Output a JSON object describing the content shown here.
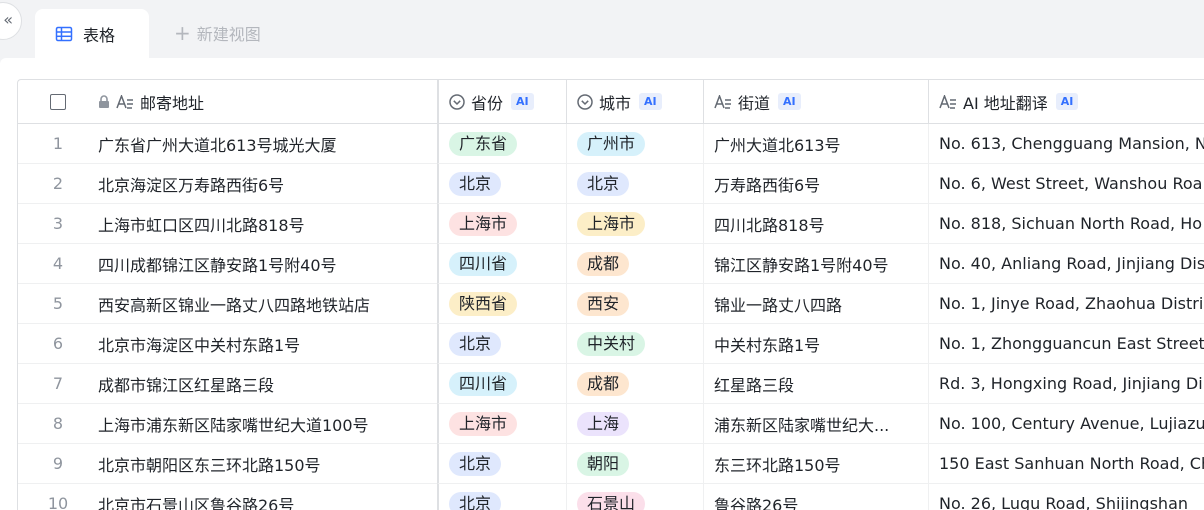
{
  "tabs": {
    "active_label": "表格",
    "new_view_label": "新建视图"
  },
  "columns": {
    "address": "邮寄地址",
    "province": "省份",
    "city": "城市",
    "street": "街道",
    "translation": "AI 地址翻译",
    "ai_badge": "AI"
  },
  "tag_colors": {
    "green": "#d9f5e5",
    "blue": "#dfe8fd",
    "red": "#fde2e2",
    "yellow": "#fceec7",
    "cyan": "#d6f1fb",
    "orange": "#fde6cf",
    "purple": "#ebe3fc",
    "pink": "#fbdfea"
  },
  "rows": [
    {
      "index": "1",
      "address": "广东省广州大道北613号城光大厦",
      "province": "广东省",
      "province_color": "green",
      "city": "广州市",
      "city_color": "cyan",
      "street": "广州大道北613号",
      "translation": "No. 613, Chengguang Mansion, N"
    },
    {
      "index": "2",
      "address": "北京海淀区万寿路西街6号",
      "province": "北京",
      "province_color": "blue",
      "city": "北京",
      "city_color": "blue",
      "street": "万寿路西街6号",
      "translation": "No. 6, West Street, Wanshou Roa"
    },
    {
      "index": "3",
      "address": "上海市虹口区四川北路818号",
      "province": "上海市",
      "province_color": "red",
      "city": "上海市",
      "city_color": "yellow",
      "street": "四川北路818号",
      "translation": "No. 818, Sichuan North Road, Ho"
    },
    {
      "index": "4",
      "address": "四川成都锦江区静安路1号附40号",
      "province": "四川省",
      "province_color": "cyan",
      "city": "成都",
      "city_color": "orange",
      "street": "锦江区静安路1号附40号",
      "translation": "No. 40, Anliang Road, Jinjiang Dis"
    },
    {
      "index": "5",
      "address": "西安高新区锦业一路丈八四路地铁站店",
      "province": "陕西省",
      "province_color": "yellow",
      "city": "西安",
      "city_color": "orange",
      "street": "锦业一路丈八四路",
      "translation": "No. 1, Jinye Road, Zhaohua Distri"
    },
    {
      "index": "6",
      "address": "北京市海淀区中关村东路1号",
      "province": "北京",
      "province_color": "blue",
      "city": "中关村",
      "city_color": "green",
      "street": "中关村东路1号",
      "translation": "No. 1, Zhongguancun East Street,"
    },
    {
      "index": "7",
      "address": "成都市锦江区红星路三段",
      "province": "四川省",
      "province_color": "cyan",
      "city": "成都",
      "city_color": "orange",
      "street": "红星路三段",
      "translation": "Rd. 3, Hongxing Road, Jinjiang Di"
    },
    {
      "index": "8",
      "address": "上海市浦东新区陆家嘴世纪大道100号",
      "province": "上海市",
      "province_color": "red",
      "city": "上海",
      "city_color": "purple",
      "street": "浦东新区陆家嘴世纪大...",
      "translation": "No. 100, Century Avenue, Lujiazu"
    },
    {
      "index": "9",
      "address": "北京市朝阳区东三环北路150号",
      "province": "北京",
      "province_color": "blue",
      "city": "朝阳",
      "city_color": "green",
      "street": "东三环北路150号",
      "translation": "150 East Sanhuan North Road, Ch"
    },
    {
      "index": "10",
      "address": "北京市石景山区鲁谷路26号",
      "province": "北京",
      "province_color": "blue",
      "city": "石景山",
      "city_color": "pink",
      "street": "鲁谷路26号",
      "translation": "No. 26, Lugu Road, Shijingshan"
    }
  ]
}
